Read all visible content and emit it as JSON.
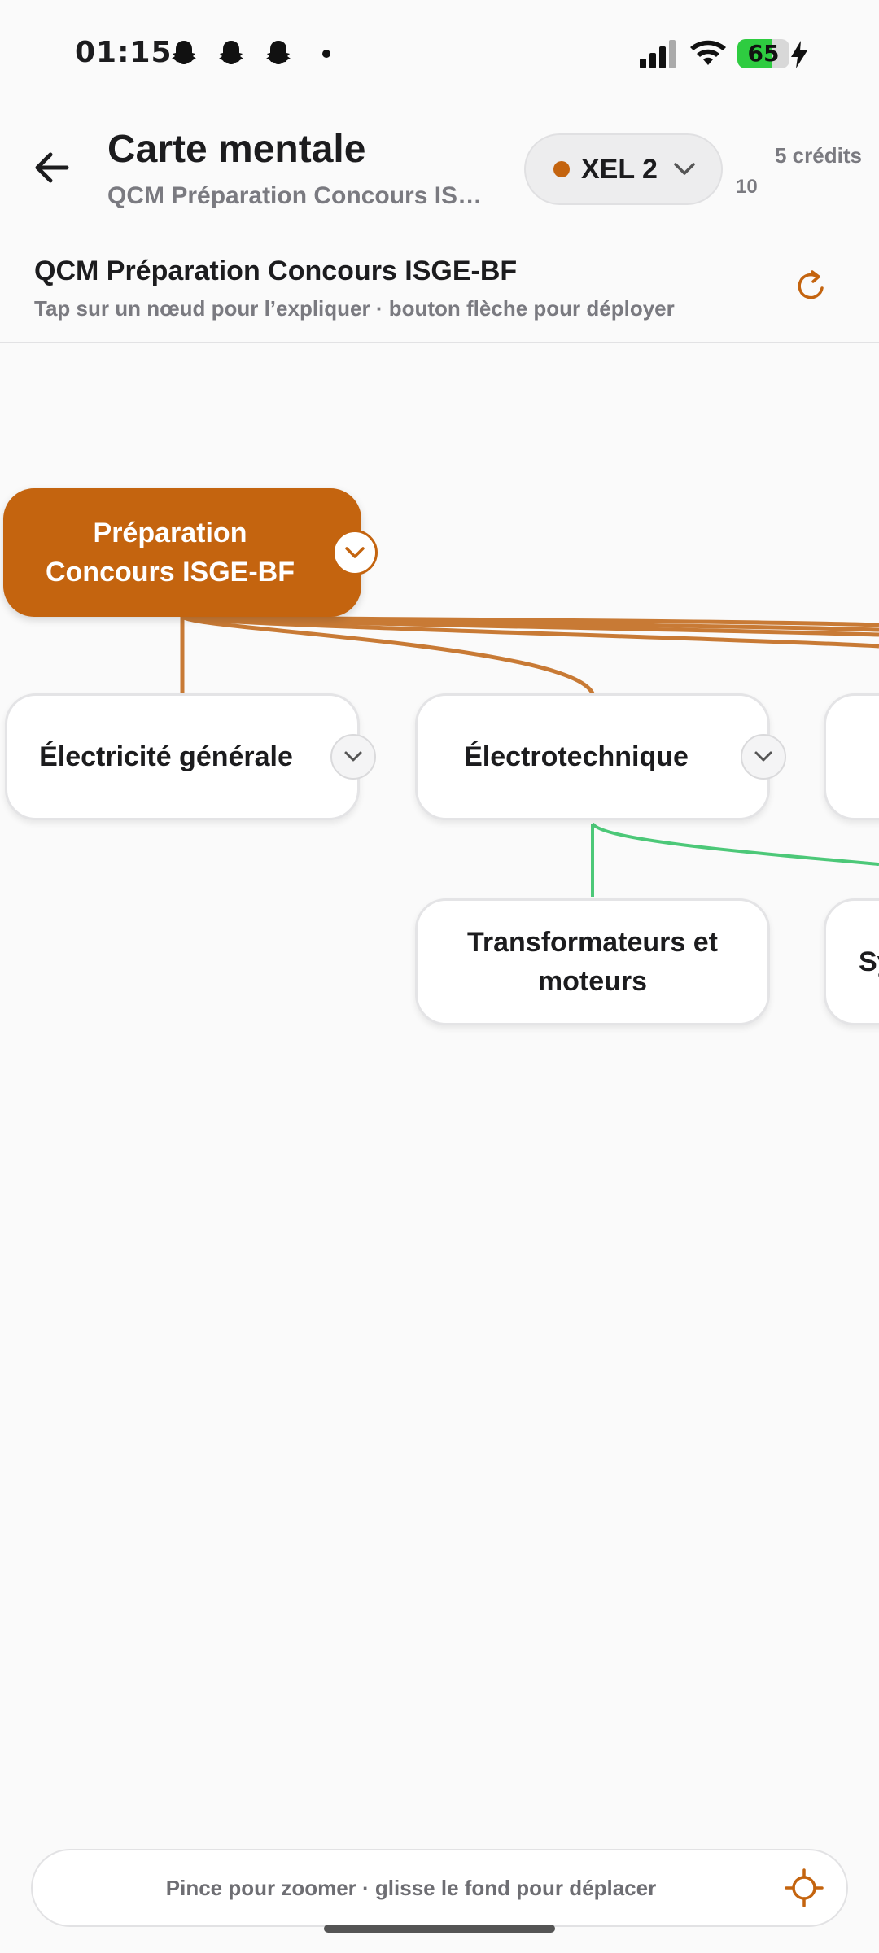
{
  "status_bar": {
    "time": "01:15",
    "battery_level": "65",
    "battery_fraction": 0.65,
    "notification_icons": [
      "snapchat-ghost-icon",
      "snapchat-ghost-icon",
      "snapchat-ghost-icon"
    ]
  },
  "header": {
    "title": "Carte mentale",
    "subtitle": "QCM Préparation Concours ISGE-BF",
    "model_label": "XEL 2",
    "credits_label": "5 crédits",
    "credits_count": "10"
  },
  "document": {
    "title": "QCM Préparation Concours ISGE-BF",
    "hint": "Tap sur un nœud pour l’expliquer · bouton flèche pour déployer"
  },
  "mindmap": {
    "root": {
      "label": "Préparation Concours ISGE-BF"
    },
    "children": [
      {
        "label": "Électricité générale"
      },
      {
        "label": "Électrotechnique"
      },
      {
        "label": ""
      }
    ],
    "grandchildren": [
      {
        "label": "Transformateurs et moteurs"
      },
      {
        "label": "Sy"
      }
    ]
  },
  "footer": {
    "hint": "Pince pour zoomer · glisse le fond pour déplacer"
  },
  "colors": {
    "accent": "#c4640f",
    "edge_root": "#c87a35",
    "edge_green": "#4cc878",
    "text_primary": "#1c1c1e",
    "text_secondary": "#7a7a80"
  }
}
